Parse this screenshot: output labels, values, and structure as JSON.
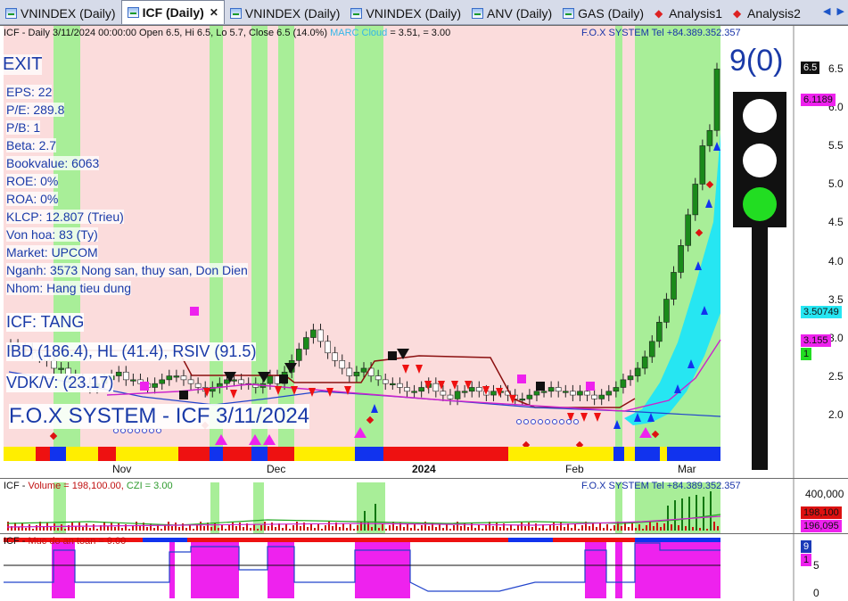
{
  "tabs": [
    {
      "label": "VNINDEX (Daily)",
      "icon": "chart-icon",
      "active": false
    },
    {
      "label": "ICF (Daily)",
      "icon": "chart-icon",
      "active": true
    },
    {
      "label": "VNINDEX (Daily)",
      "icon": "chart-icon",
      "active": false
    },
    {
      "label": "VNINDEX (Daily)",
      "icon": "chart-icon",
      "active": false
    },
    {
      "label": "ANV (Daily)",
      "icon": "chart-icon",
      "active": false
    },
    {
      "label": "GAS (Daily)",
      "icon": "chart-icon",
      "active": false
    },
    {
      "label": "Analysis1",
      "icon": "analysis-icon",
      "active": false
    },
    {
      "label": "Analysis2",
      "icon": "analysis-icon",
      "active": false
    }
  ],
  "tab_close": "✕",
  "tab_scroll": "◀ ▶",
  "main": {
    "header": "ICF - Daily 3/11/2024 00:00:00 Open 6.5, Hi 6.5, Lo 5.7, Close 6.5 (14.0%)",
    "marc": "MARC Cloud",
    "marc_values": "= 3.51,   = 3.00",
    "fox_contact": "F.O.X SYSTEM Tel +84.389.352.357",
    "exit_label": "EXIT",
    "fundamentals": [
      "EPS: 22",
      "P/E: 289.8",
      "P/B: 1",
      "Beta: 2.7",
      "Bookvalue: 6063",
      "ROE: 0%",
      "ROA: 0%",
      "KLCP: 12.807 (Trieu)",
      "Von hoa: 83 (Ty)",
      "Market: UPCOM",
      "Nganh: 3573 Nong san, thuy san, Don Dien",
      "Nhom: Hang tieu dung"
    ],
    "trend": "ICF: TANG",
    "ratings": "IBD (186.4), HL (41.4), RSIV (91.5)",
    "vdk": "VDK/V:  (23.17)",
    "title": "F.O.X SYSTEM - ICF 3/11/2024",
    "score": "9(0)",
    "traffic_light": {
      "top": "#ffffff",
      "middle": "#ffffff",
      "bottom": "#22dd22"
    },
    "price_axis": [
      "6.5",
      "6.0",
      "5.5",
      "5.0",
      "4.5",
      "4.0",
      "3.5",
      "3.0",
      "2.5",
      "2.0"
    ],
    "badges": {
      "close": "6.5",
      "upper": "6.1189",
      "cloud": "3.50749",
      "lower": "3.155",
      "count": "1"
    },
    "months": [
      "Nov",
      "Dec",
      "2024",
      "Feb",
      "Mar"
    ]
  },
  "volume": {
    "label": "ICF - ",
    "vol": "Volume = 198,100.00,",
    "czi": "CZI = 3.00",
    "fox_contact": "F.O.X SYSTEM Tel +84.389.352.357",
    "axis": "400,000",
    "badge_vol": "198,100",
    "badge_ma": "196,095"
  },
  "safety": {
    "label": "ICF - ",
    "title": "Muc do an toan = 9.00",
    "axis": [
      "5",
      "0"
    ],
    "badge_value": "9",
    "badge_level": "1"
  },
  "colors": {
    "green_zone": "#a8ee98",
    "pink_zone": "#fbdcdc",
    "cyan_cloud": "#26e6f2",
    "up_candle": "#1a8a1a",
    "trend_line": "#8b1010",
    "accent": "#1a3aa8"
  },
  "chart_data": {
    "type": "candlestick",
    "title": "ICF - Daily 3/11/2024",
    "ylim": [
      1.6,
      6.9
    ],
    "close_series": [
      2.9,
      2.85,
      2.85,
      2.8,
      2.75,
      2.7,
      2.6,
      2.6,
      2.5,
      2.45,
      2.4,
      2.35,
      2.4,
      2.45,
      2.5,
      2.55,
      2.45,
      2.45,
      2.4,
      2.35,
      2.4,
      2.45,
      2.5,
      2.5,
      2.45,
      2.4,
      2.35,
      2.3,
      2.35,
      2.4,
      2.45,
      2.45,
      2.4,
      2.4,
      2.35,
      2.4,
      2.5,
      2.4,
      2.55,
      2.7,
      2.85,
      3.0,
      3.1,
      2.95,
      2.8,
      2.7,
      2.6,
      2.5,
      2.55,
      2.6,
      2.5,
      2.45,
      2.4,
      2.4,
      2.35,
      2.3,
      2.3,
      2.35,
      2.4,
      2.3,
      2.25,
      2.2,
      2.3,
      2.3,
      2.35,
      2.3,
      2.25,
      2.3,
      2.3,
      2.25,
      2.2,
      2.2,
      2.25,
      2.3,
      2.3,
      2.35,
      2.3,
      2.3,
      2.25,
      2.3,
      2.25,
      2.2,
      2.25,
      2.3,
      2.35,
      2.45,
      2.5,
      2.6,
      2.75,
      2.95,
      3.2,
      3.5,
      3.85,
      4.2,
      4.6,
      5.0,
      5.5,
      5.7,
      6.5
    ]
  }
}
